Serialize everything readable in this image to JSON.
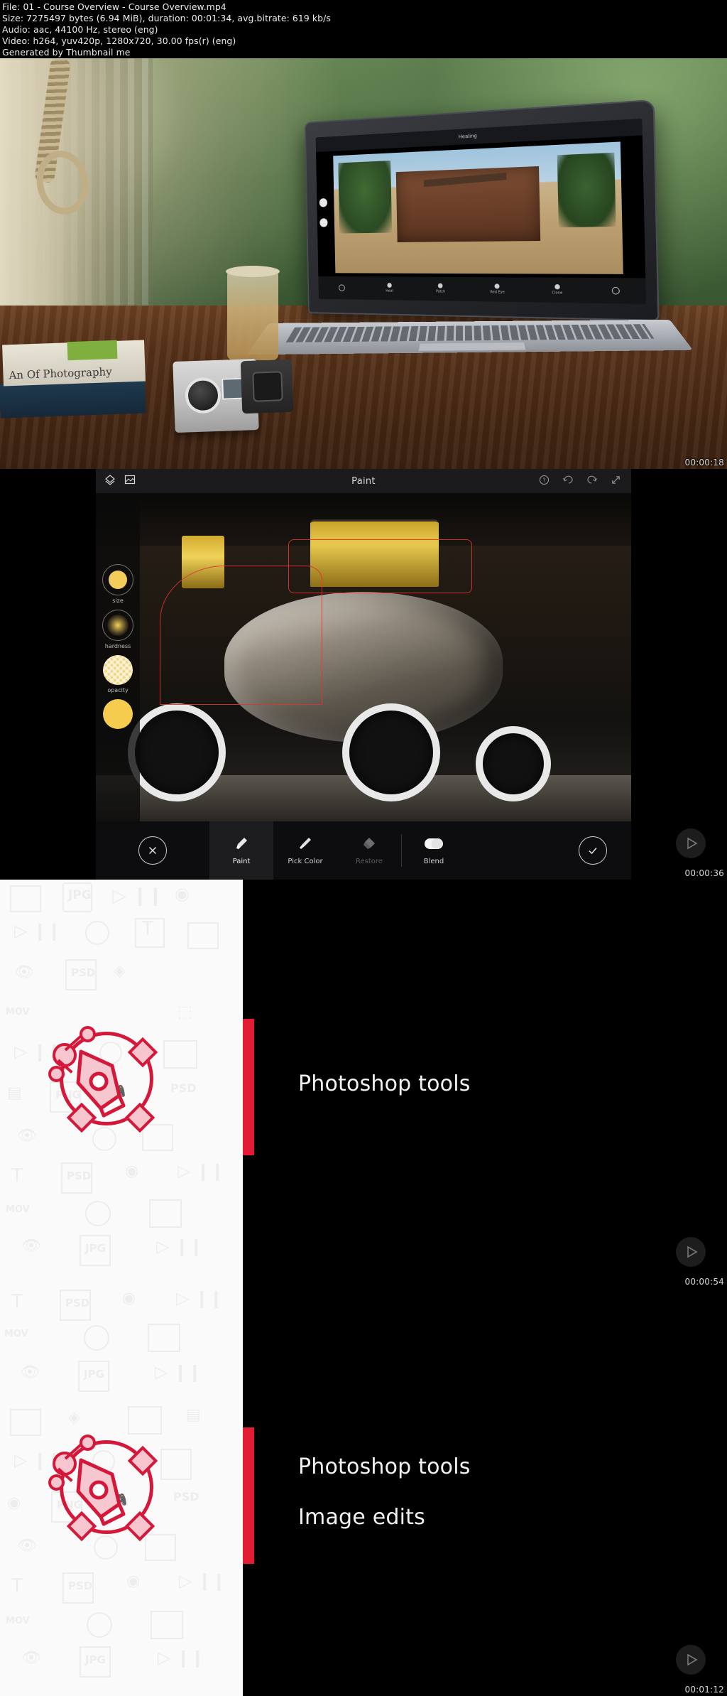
{
  "header": {
    "lines": [
      "File: 01 - Course Overview - Course Overview.mp4",
      "Size: 7275497 bytes (6.94 MiB), duration: 00:01:34, avg.bitrate: 619 kb/s",
      "Audio: aac, 44100 Hz, stereo (eng)",
      "Video: h264, yuv420p, 1280x720, 30.00 fps(r) (eng)",
      "Generated by Thumbnail me"
    ]
  },
  "thumbnails": [
    {
      "timestamp": "00:00:18",
      "has_play_overlay": false
    },
    {
      "timestamp": "00:00:36",
      "has_play_overlay": true
    },
    {
      "timestamp": "00:00:54",
      "has_play_overlay": true
    },
    {
      "timestamp": "00:01:12",
      "has_play_overlay": true
    }
  ],
  "frame1": {
    "book_title": "An Of Photography",
    "laptop_app": {
      "title": "Healing",
      "tools": [
        "Heal",
        "Patch",
        "Red Eye",
        "Clone"
      ]
    }
  },
  "frame2": {
    "app_title": "Paint",
    "topbar_icons": [
      "layers-icon",
      "image-icon",
      "help-icon",
      "undo-icon",
      "redo-icon",
      "expand-icon"
    ],
    "sliders": [
      {
        "label": "size",
        "icon": "brush-size-swatch"
      },
      {
        "label": "hardness",
        "icon": "brush-hardness-swatch"
      },
      {
        "label": "opacity",
        "icon": "brush-opacity-swatch"
      }
    ],
    "color_swatch": "#f5cc4e",
    "toolbar": {
      "cancel": "cancel-icon",
      "confirm": "confirm-icon",
      "tools": [
        {
          "label": "Paint",
          "icon": "brush-icon",
          "state": "active"
        },
        {
          "label": "Pick Color",
          "icon": "eyedropper-icon",
          "state": "normal"
        },
        {
          "label": "Restore",
          "icon": "eraser-icon",
          "state": "disabled"
        },
        {
          "label": "Blend",
          "icon": "blend-icon",
          "state": "normal"
        }
      ]
    }
  },
  "frame3": {
    "logo": "pen-tool-logo",
    "lines": [
      "Photoshop tools"
    ],
    "accent_color": "#e31b35"
  },
  "frame4": {
    "logo": "pen-tool-logo",
    "lines": [
      "Photoshop tools",
      "Image edits"
    ],
    "accent_color": "#e31b35"
  }
}
